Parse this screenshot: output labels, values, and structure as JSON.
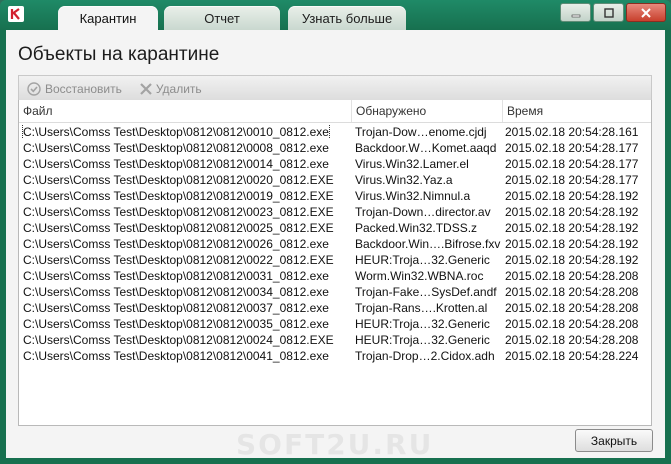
{
  "window": {
    "tabs": [
      {
        "label": "Карантин",
        "active": true
      },
      {
        "label": "Отчет",
        "active": false
      },
      {
        "label": "Узнать больше",
        "active": false
      }
    ],
    "controls": [
      "minimize-icon",
      "maximize-icon",
      "close-icon"
    ]
  },
  "page": {
    "title": "Объекты на карантине"
  },
  "toolbar": {
    "restore_label": "Восстановить",
    "delete_label": "Удалить"
  },
  "table": {
    "columns": [
      "Файл",
      "Обнаружено",
      "Время"
    ],
    "rows": [
      [
        "C:\\Users\\Comss Test\\Desktop\\0812\\0812\\0010_0812.exe",
        "Trojan-Dow…enome.cjdj",
        "2015.02.18 20:54:28.161"
      ],
      [
        "C:\\Users\\Comss Test\\Desktop\\0812\\0812\\0008_0812.exe",
        "Backdoor.W…Komet.aaqd",
        "2015.02.18 20:54:28.177"
      ],
      [
        "C:\\Users\\Comss Test\\Desktop\\0812\\0812\\0014_0812.exe",
        "Virus.Win32.Lamer.el",
        "2015.02.18 20:54:28.177"
      ],
      [
        "C:\\Users\\Comss Test\\Desktop\\0812\\0812\\0020_0812.EXE",
        "Virus.Win32.Yaz.a",
        "2015.02.18 20:54:28.177"
      ],
      [
        "C:\\Users\\Comss Test\\Desktop\\0812\\0812\\0019_0812.EXE",
        "Virus.Win32.Nimnul.a",
        "2015.02.18 20:54:28.192"
      ],
      [
        "C:\\Users\\Comss Test\\Desktop\\0812\\0812\\0023_0812.EXE",
        "Trojan-Down…director.av",
        "2015.02.18 20:54:28.192"
      ],
      [
        "C:\\Users\\Comss Test\\Desktop\\0812\\0812\\0025_0812.EXE",
        "Packed.Win32.TDSS.z",
        "2015.02.18 20:54:28.192"
      ],
      [
        "C:\\Users\\Comss Test\\Desktop\\0812\\0812\\0026_0812.exe",
        "Backdoor.Win….Bifrose.fxv",
        "2015.02.18 20:54:28.192"
      ],
      [
        "C:\\Users\\Comss Test\\Desktop\\0812\\0812\\0022_0812.EXE",
        "HEUR:Troja…32.Generic",
        "2015.02.18 20:54:28.192"
      ],
      [
        "C:\\Users\\Comss Test\\Desktop\\0812\\0812\\0031_0812.exe",
        "Worm.Win32.WBNA.roc",
        "2015.02.18 20:54:28.208"
      ],
      [
        "C:\\Users\\Comss Test\\Desktop\\0812\\0812\\0034_0812.exe",
        "Trojan-Fake…SysDef.andf",
        "2015.02.18 20:54:28.208"
      ],
      [
        "C:\\Users\\Comss Test\\Desktop\\0812\\0812\\0037_0812.exe",
        "Trojan-Rans….Krotten.al",
        "2015.02.18 20:54:28.208"
      ],
      [
        "C:\\Users\\Comss Test\\Desktop\\0812\\0812\\0035_0812.exe",
        "HEUR:Troja…32.Generic",
        "2015.02.18 20:54:28.208"
      ],
      [
        "C:\\Users\\Comss Test\\Desktop\\0812\\0812\\0024_0812.EXE",
        "HEUR:Troja…32.Generic",
        "2015.02.18 20:54:28.208"
      ],
      [
        "C:\\Users\\Comss Test\\Desktop\\0812\\0812\\0041_0812.exe",
        "Trojan-Drop…2.Cidox.adh",
        "2015.02.18 20:54:28.224"
      ]
    ]
  },
  "footer": {
    "close_label": "Закрыть"
  },
  "watermark": "SOFT2U.RU",
  "colors": {
    "frame": "#17704f",
    "accent_red": "#c8402d",
    "client_bg": "#f4f4f4"
  }
}
